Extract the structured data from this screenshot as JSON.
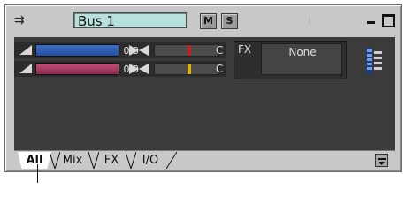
{
  "title_bar": {
    "name": "Bus 1",
    "mute_label": "M",
    "solo_label": "S",
    "route_icon": "output-routing-icon",
    "minimize_icon": "minimize-icon",
    "maximize_icon": "maximize-icon"
  },
  "strips": [
    {
      "volume_value": "0.0",
      "pan_value": "C",
      "fader_color": "#3e6fc8",
      "pan_mark_color": "#c82020"
    },
    {
      "volume_value": "0.0",
      "pan_value": "C",
      "fader_color": "#c24e78",
      "pan_mark_color": "#e0b010"
    }
  ],
  "fx": {
    "label": "FX",
    "slot_value": "None"
  },
  "tabs": [
    {
      "label": "All",
      "selected": true
    },
    {
      "label": "Mix",
      "selected": false
    },
    {
      "label": "FX",
      "selected": false
    },
    {
      "label": "I/O",
      "selected": false
    }
  ],
  "colors": {
    "name_field_bg": "#b8e0dc",
    "body_bg": "#3b3b3b",
    "chrome_bg": "#c8c8c8"
  }
}
